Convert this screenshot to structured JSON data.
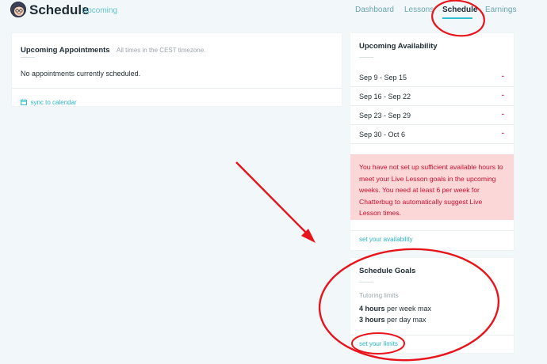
{
  "header": {
    "brand": "Schedule",
    "subtitle": "Upcoming",
    "nav": [
      "Dashboard",
      "Lessons",
      "Schedule",
      "Earnings"
    ],
    "active_nav": "Schedule"
  },
  "appointments": {
    "title": "Upcoming Appointments",
    "timezone_note": "All times in the CEST timezone.",
    "empty_message": "No appointments currently scheduled.",
    "sync_link": "sync to calendar"
  },
  "availability": {
    "title": "Upcoming Availability",
    "weeks": [
      {
        "label": "Sep 9 - Sep 15",
        "value": "-"
      },
      {
        "label": "Sep 16 - Sep 22",
        "value": "-"
      },
      {
        "label": "Sep 23 - Sep 29",
        "value": "-"
      },
      {
        "label": "Sep 30 - Oct 6",
        "value": "-"
      }
    ],
    "warning": "You have not set up sufficient available hours to meet your Live Lesson goals in the upcoming weeks. You need at least 6 per week for Chatterbug to automatically suggest Live Lesson times.",
    "link": "set your availability"
  },
  "goals": {
    "title": "Schedule Goals",
    "subheading": "Tutoring limits",
    "limits": [
      {
        "amount": "4 hours",
        "rest": "per week max"
      },
      {
        "amount": "3 hours",
        "rest": "per day max"
      }
    ],
    "link": "set your limits"
  },
  "colors": {
    "accent": "#2ec0d2",
    "link": "#2ab6c8",
    "warning_bg": "#fcd7d8",
    "warning_text": "#c8102e",
    "annotation": "#e8141c"
  }
}
